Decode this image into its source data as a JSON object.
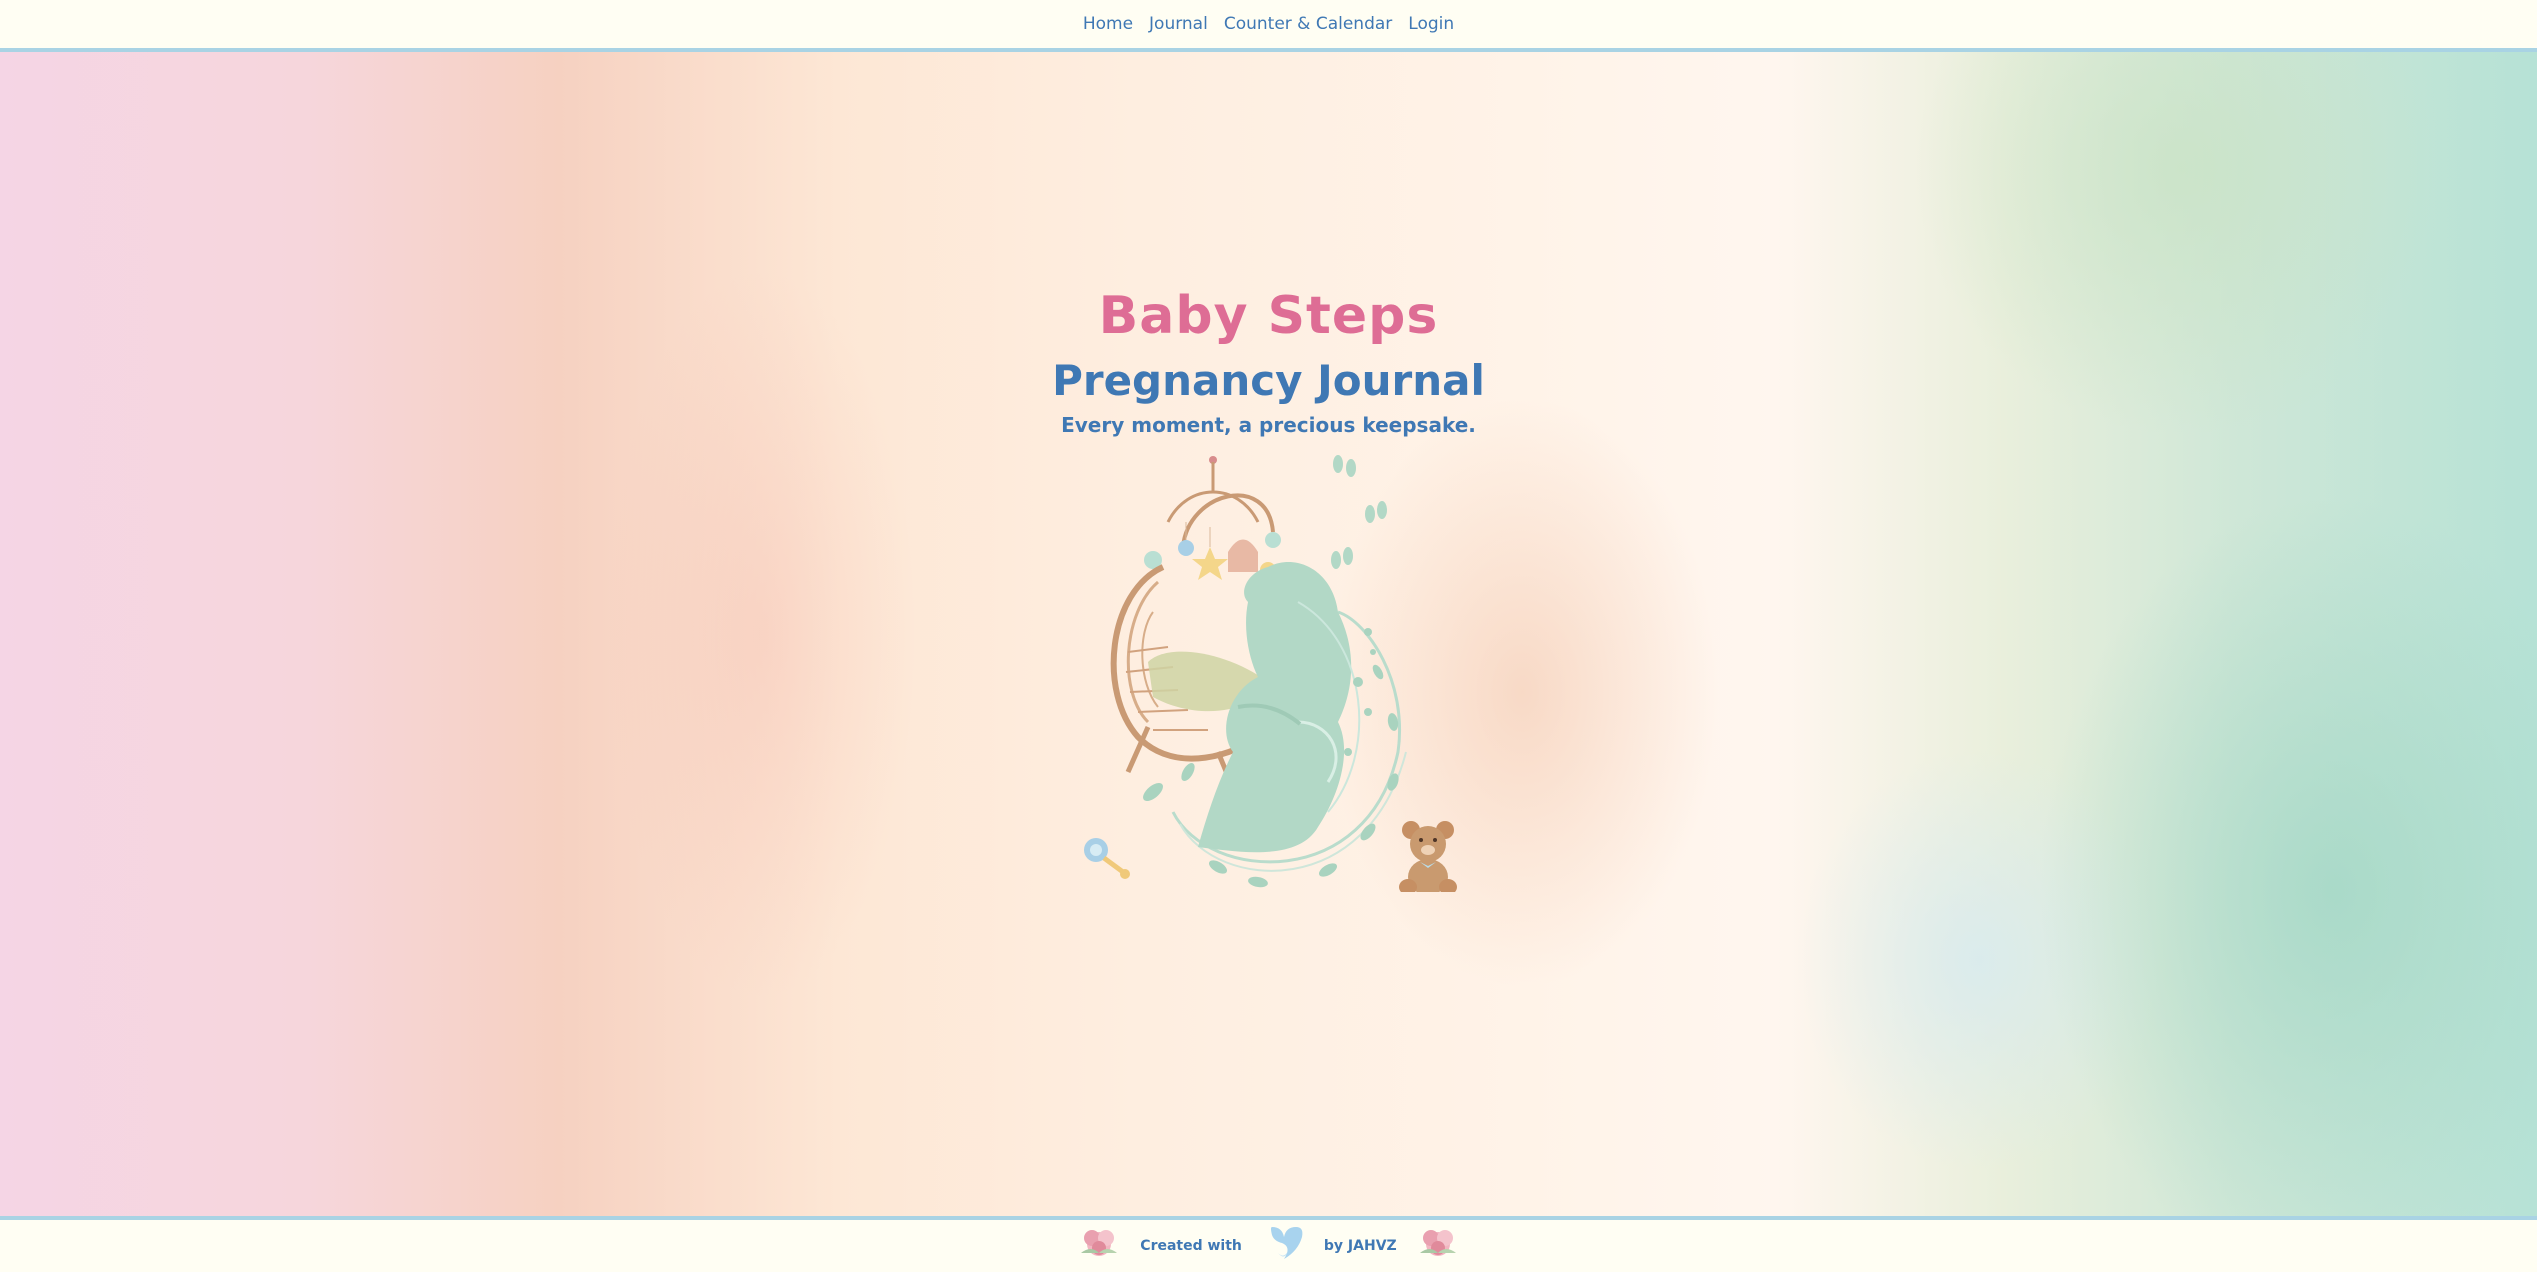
{
  "nav": {
    "items": [
      {
        "label": "Home"
      },
      {
        "label": "Journal"
      },
      {
        "label": "Counter & Calendar"
      },
      {
        "label": "Login"
      }
    ]
  },
  "hero": {
    "title": "Baby Steps",
    "subtitle": "Pregnancy Journal",
    "tagline": "Every moment, a precious keepsake."
  },
  "footer": {
    "created_with": "Created with",
    "by": "by JAHVZ"
  },
  "colors": {
    "accent_pink": "#de6d95",
    "accent_blue": "#3f78b4",
    "border_blue": "#a9d3e4",
    "bar_bg": "#fffef3",
    "illustration_mint": "#b2d8c6"
  },
  "icons": [
    "mother-baby-illustration-icon",
    "teddy-bear-icon",
    "rattle-icon",
    "baby-footprints-icon",
    "flower-icon",
    "heart-footprint-icon"
  ]
}
